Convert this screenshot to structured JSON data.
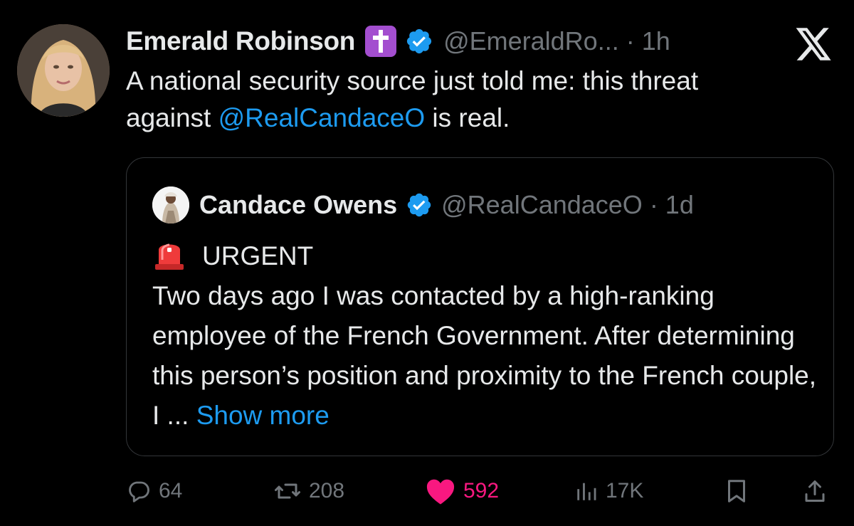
{
  "tweet": {
    "author": {
      "display_name": "Emerald Robinson",
      "handle": "@EmeraldRo...",
      "time": " · 1h"
    },
    "text_line1": "A national security source just told me: this threat",
    "text_before_mention": "against ",
    "mention": "@RealCandaceO",
    "text_after_mention": " is real.",
    "quoted": {
      "display_name": "Candace Owens",
      "handle": "@RealCandaceO",
      "time": " · 1d",
      "urgent_label": "URGENT",
      "body": "Two days ago I was contacted by a high-ranking employee of the French Government. After determining this person’s position and proximity to the French couple, I ... ",
      "show_more": "Show more"
    },
    "stats": {
      "replies": "64",
      "reposts": "208",
      "likes": "592",
      "views": "17K"
    }
  },
  "icons": {
    "cross_badge": "latin-cross-icon",
    "verified": "verified-badge-icon",
    "logo": "x-logo-icon",
    "siren": "police-light-icon",
    "reply": "reply-icon",
    "repost": "repost-icon",
    "like": "heart-icon",
    "views": "views-icon",
    "bookmark": "bookmark-icon",
    "share": "share-icon"
  },
  "colors": {
    "background": "#000000",
    "text": "#e7e9ea",
    "muted": "#71767b",
    "link": "#1d9bf0",
    "like": "#f91880",
    "cross_badge_bg": "#a34ecf",
    "border": "#333639"
  }
}
